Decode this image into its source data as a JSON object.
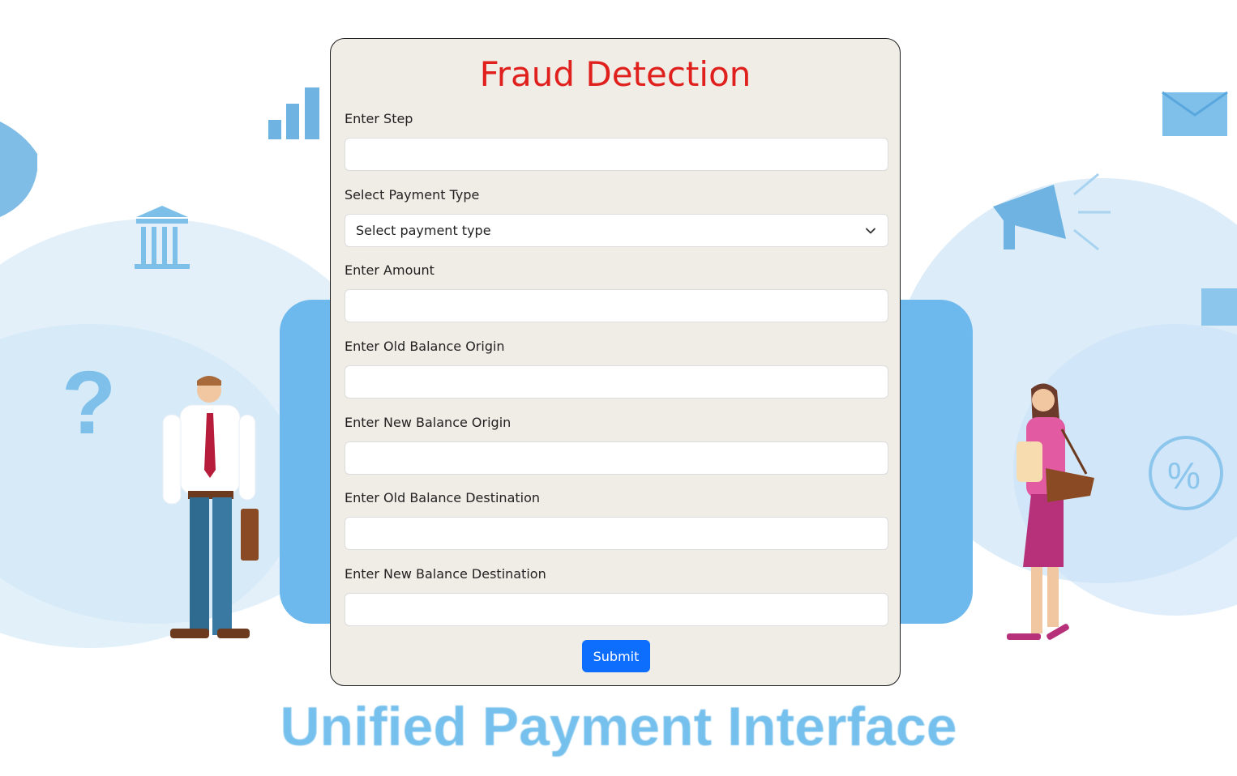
{
  "page": {
    "title": "Fraud Detection",
    "title_color": "#e0201d",
    "background_brand_text": "Unified Payment Interface"
  },
  "form": {
    "fields": [
      {
        "label": "Enter Step",
        "value": "",
        "type": "text"
      },
      {
        "label": "Select Payment Type",
        "value": "Select payment type",
        "type": "select"
      },
      {
        "label": "Enter Amount",
        "value": "",
        "type": "text"
      },
      {
        "label": "Enter Old Balance Origin",
        "value": "",
        "type": "text"
      },
      {
        "label": "Enter New Balance Origin",
        "value": "",
        "type": "text"
      },
      {
        "label": "Enter Old Balance Destination",
        "value": "",
        "type": "text"
      },
      {
        "label": "Enter New Balance Destination",
        "value": "",
        "type": "text"
      }
    ],
    "submit_label": "Submit",
    "submit_color": "#0d6efd"
  },
  "icons": [
    "bar-chart-icon",
    "bank-icon",
    "question-mark-icon",
    "megaphone-icon",
    "envelope-icon",
    "percent-icon",
    "chevron-down-icon"
  ]
}
